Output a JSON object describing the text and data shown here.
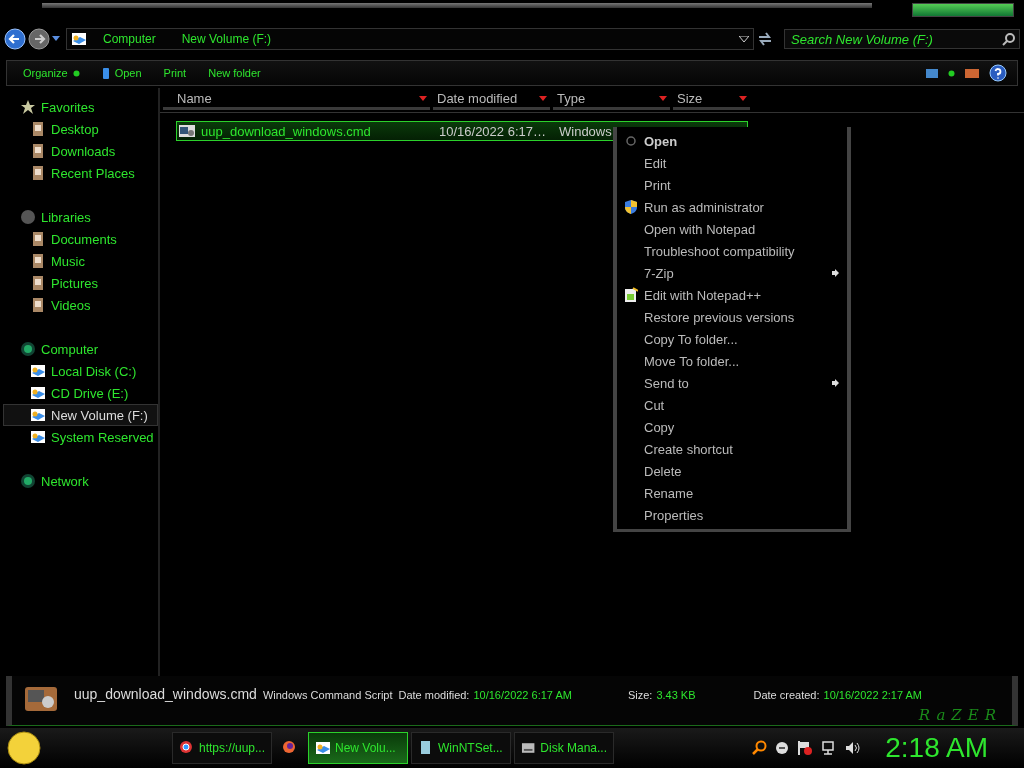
{
  "nav": {
    "path": [
      "Computer",
      "New Volume (F:)"
    ],
    "search_placeholder": "Search New Volume (F:)"
  },
  "toolbar": [
    {
      "label": "Organize",
      "kind": "menu"
    },
    {
      "label": "Open",
      "kind": "icon"
    },
    {
      "label": "Print",
      "kind": "plain"
    },
    {
      "label": "New folder",
      "kind": "plain"
    }
  ],
  "sidebar": [
    {
      "label": "Favorites",
      "kind": "star",
      "children": [
        {
          "label": "Desktop",
          "selected": false
        },
        {
          "label": "Downloads",
          "selected": false
        },
        {
          "label": "Recent Places",
          "selected": false
        }
      ]
    },
    {
      "label": "Libraries",
      "kind": "disc",
      "children": [
        {
          "label": "Documents",
          "selected": false
        },
        {
          "label": "Music",
          "selected": false
        },
        {
          "label": "Pictures",
          "selected": false
        },
        {
          "label": "Videos",
          "selected": false
        }
      ]
    },
    {
      "label": "Computer",
      "kind": "orb",
      "children": [
        {
          "label": "Local Disk (C:)",
          "selected": false
        },
        {
          "label": "CD Drive (E:)",
          "selected": false
        },
        {
          "label": "New Volume (F:)",
          "selected": true
        },
        {
          "label": "System Reserved",
          "selected": false
        }
      ]
    },
    {
      "label": "Network",
      "kind": "orb"
    }
  ],
  "columns": [
    "Name",
    "Date modified",
    "Type",
    "Size"
  ],
  "rows": [
    {
      "name": "uup_download_windows.cmd",
      "date_modified": "10/16/2022 6:17…",
      "type": "Windows",
      "selected": true
    }
  ],
  "context_menu": [
    {
      "label": "Open",
      "kind": "default"
    },
    {
      "label": "Edit",
      "kind": "plain"
    },
    {
      "label": "Print",
      "kind": "plain"
    },
    {
      "label": "Run as administrator",
      "kind": "elevated"
    },
    {
      "label": "Open with Notepad",
      "kind": "plain"
    },
    {
      "label": "Troubleshoot compatibility",
      "kind": "plain"
    },
    {
      "label": "7-Zip",
      "kind": "submenu"
    },
    {
      "label": "Edit with Notepad++",
      "kind": "editor"
    },
    {
      "label": "Restore previous versions",
      "kind": "plain"
    },
    {
      "label": "Copy To folder...",
      "kind": "plain"
    },
    {
      "label": "Move To folder...",
      "kind": "plain"
    },
    {
      "label": "Send to",
      "kind": "submenu"
    },
    {
      "label": "Cut",
      "kind": "plain"
    },
    {
      "label": "Copy",
      "kind": "plain"
    },
    {
      "label": "Create shortcut",
      "kind": "plain"
    },
    {
      "label": "Delete",
      "kind": "plain"
    },
    {
      "label": "Rename",
      "kind": "plain"
    },
    {
      "label": "Properties",
      "kind": "plain"
    }
  ],
  "details": {
    "file_name": "uup_download_windows.cmd",
    "file_type": "Windows Command Script",
    "fields": [
      {
        "label": "Date modified:",
        "value": "10/16/2022 6:17 AM"
      },
      {
        "label": "Size:",
        "value": "3.43 KB"
      },
      {
        "label": "Date created:",
        "value": "10/16/2022 2:17 AM"
      }
    ],
    "logo": "RaZER"
  },
  "taskbar": {
    "tasks": [
      {
        "label": "https://uup...",
        "kind": "browser",
        "selected": false
      },
      {
        "kind": "fox",
        "selected": false
      },
      {
        "label": "New Volu...",
        "kind": "folder",
        "selected": true
      },
      {
        "label": "WinNTSet...",
        "kind": "doc",
        "selected": false
      },
      {
        "label": "Disk Mana...",
        "kind": "disk",
        "selected": false
      }
    ],
    "clock": "2:18 AM"
  }
}
